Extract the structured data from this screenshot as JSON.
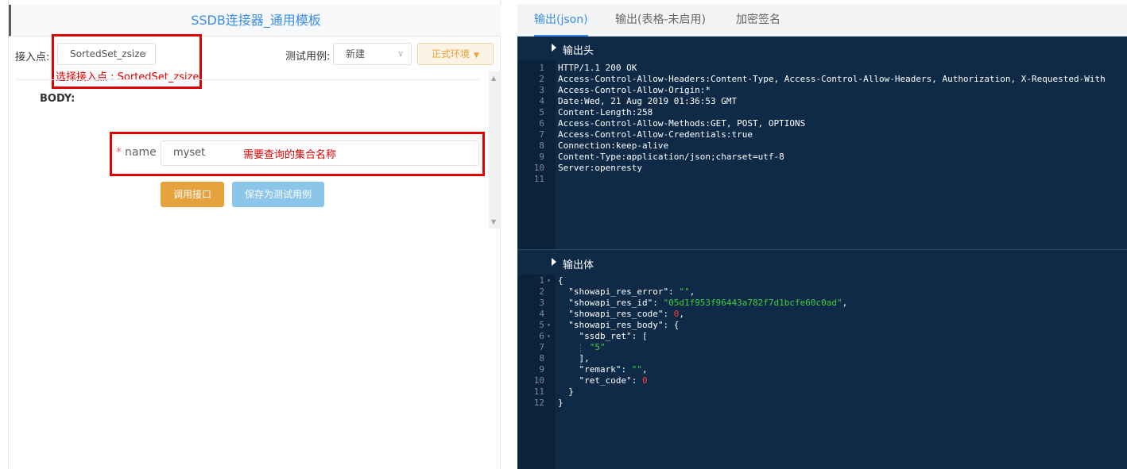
{
  "left": {
    "title": "SSDB连接器_通用模板",
    "endpoint_label": "接入点:",
    "endpoint_value": "SortedSet_zsize",
    "testcase_label": "测试用例:",
    "testcase_value": "新建",
    "env_button": "正式环境",
    "annotation_endpoint": "选择接入点 : SortedSet_zsize",
    "body_label": "BODY:",
    "name_required_star": "*",
    "name_label": "name",
    "name_value": "myset",
    "annotation_name": "需要查询的集合名称",
    "call_button": "调用接口",
    "save_button": "保存为测试用例"
  },
  "right": {
    "tabs": [
      "输出(json)",
      "输出(表格-未启用)",
      "加密签名"
    ],
    "active_tab": 0,
    "header_section_title": "输出头",
    "header_lines": [
      "HTTP/1.1 200 OK",
      "Access-Control-Allow-Headers:Content-Type, Access-Control-Allow-Headers, Authorization, X-Requested-With",
      "Access-Control-Allow-Origin:*",
      "Date:Wed, 21 Aug 2019 01:36:53 GMT",
      "Content-Length:258",
      "Access-Control-Allow-Methods:GET, POST, OPTIONS",
      "Access-Control-Allow-Credentials:true",
      "Connection:keep-alive",
      "Content-Type:application/json;charset=utf-8",
      "Server:openresty",
      ""
    ],
    "body_section_title": "输出体",
    "body_lines": [
      {
        "n": "1",
        "fold": true,
        "parts": [
          [
            "key",
            "{"
          ]
        ]
      },
      {
        "n": "2",
        "parts": [
          [
            "key",
            "  \"showapi_res_error\": "
          ],
          [
            "str",
            "\"\""
          ],
          [
            "key",
            ","
          ]
        ]
      },
      {
        "n": "3",
        "parts": [
          [
            "key",
            "  \"showapi_res_id\": "
          ],
          [
            "str",
            "\"05d1f953f96443a782f7d1bcfe60c0ad\""
          ],
          [
            "key",
            ","
          ]
        ]
      },
      {
        "n": "4",
        "parts": [
          [
            "key",
            "  \"showapi_res_code\": "
          ],
          [
            "numv",
            "0"
          ],
          [
            "key",
            ","
          ]
        ]
      },
      {
        "n": "5",
        "fold": true,
        "parts": [
          [
            "key",
            "  \"showapi_res_body\": {"
          ]
        ]
      },
      {
        "n": "6",
        "fold": true,
        "parts": [
          [
            "key",
            "    \"ssdb_ret\": ["
          ]
        ]
      },
      {
        "n": "7",
        "parts": [
          [
            "key",
            "      "
          ],
          [
            "str",
            "\"5\""
          ]
        ]
      },
      {
        "n": "8",
        "parts": [
          [
            "key",
            "    ],"
          ]
        ]
      },
      {
        "n": "9",
        "parts": [
          [
            "key",
            "    \"remark\": "
          ],
          [
            "str",
            "\"\""
          ],
          [
            "key",
            ","
          ]
        ]
      },
      {
        "n": "10",
        "parts": [
          [
            "key",
            "    \"ret_code\": "
          ],
          [
            "numv",
            "0"
          ]
        ]
      },
      {
        "n": "11",
        "parts": [
          [
            "key",
            "  }"
          ]
        ]
      },
      {
        "n": "12",
        "parts": [
          [
            "key",
            "}"
          ]
        ]
      }
    ]
  },
  "colors": {
    "accent_blue": "#3a8ee6",
    "warning_orange": "#e6a23c",
    "annotation_red": "#e10000",
    "editor_bg": "#0e2a47",
    "json_string": "#3fcf3f",
    "json_number": "#ff3b3b"
  }
}
